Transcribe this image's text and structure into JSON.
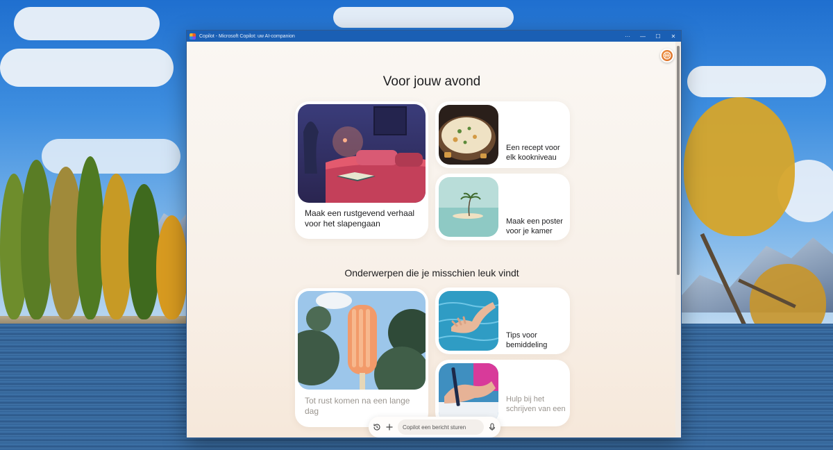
{
  "window": {
    "title": "Copilot - Microsoft Copilot: uw AI-companion",
    "controls": {
      "more": "···",
      "minimize": "—",
      "maximize": "☐",
      "close": "✕"
    }
  },
  "sections": [
    {
      "title": "Voor jouw avond",
      "cards": [
        {
          "label": "Maak een rustgevend verhaal voor het slapengaan",
          "image": "bedroom-night-image"
        },
        {
          "label": "Een recept voor elk kookniveau",
          "image": "soup-bowl-image"
        },
        {
          "label": "Maak een poster voor je kamer",
          "image": "island-palm-image"
        }
      ]
    },
    {
      "title": "Onderwerpen die je misschien leuk vindt",
      "cards": [
        {
          "label": "Tot rust komen na een lange dag",
          "image": "popsicle-image"
        },
        {
          "label": "Tips voor bemiddeling",
          "image": "hand-water-image"
        },
        {
          "label": "Hulp bij het schrijven van een",
          "image": "hand-writing-image"
        }
      ]
    }
  ],
  "composer": {
    "placeholder": "Copilot een bericht sturen",
    "history_icon": "history-icon",
    "add_icon": "plus-icon",
    "mic_icon": "microphone-icon"
  },
  "colors": {
    "titlebar": "#1a5fb4",
    "page_background": "#f7f1ea",
    "card_background": "#ffffff",
    "avatar_accent": "#e0742a"
  }
}
